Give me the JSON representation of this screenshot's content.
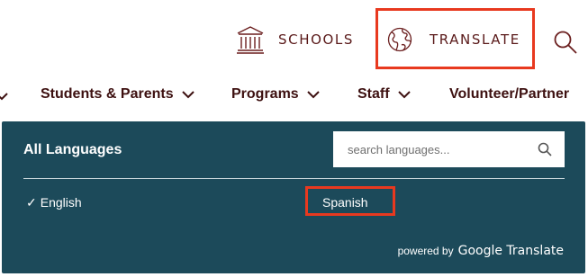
{
  "header": {
    "schools_label": "SCHOOLS",
    "translate_label": "TRANSLATE"
  },
  "nav": {
    "items": [
      {
        "label": "Students & Parents"
      },
      {
        "label": "Programs"
      },
      {
        "label": "Staff"
      },
      {
        "label": "Volunteer/Partner"
      }
    ]
  },
  "translate_panel": {
    "title": "All Languages",
    "search_placeholder": "search languages...",
    "languages": [
      {
        "label": "English",
        "selected": true
      },
      {
        "label": "Spanish",
        "selected": false
      }
    ],
    "powered_by": "powered by",
    "provider": "Google Translate"
  },
  "colors": {
    "brand": "#5a1a1a",
    "panel_bg": "#1c4a5a",
    "highlight": "#e8391f"
  },
  "icons": {
    "schools": "schoolhouse-icon",
    "translate": "globe-icon",
    "search": "search-icon",
    "nav_chevron": "chevron-down-icon",
    "check": "check-icon"
  }
}
